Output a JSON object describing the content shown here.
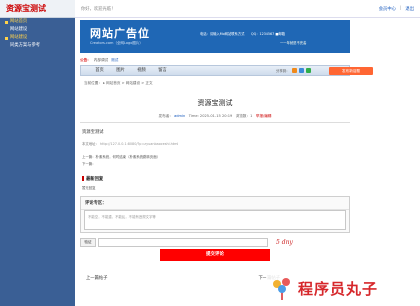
{
  "brand": {
    "title": "资源宝测试"
  },
  "sidebar": {
    "items": [
      {
        "label": "网站首页",
        "kind": "section"
      },
      {
        "label": "网站建设",
        "kind": "sub"
      },
      {
        "label": "网站建设",
        "kind": "section"
      },
      {
        "label": "同类方案与参考",
        "kind": "sub"
      }
    ]
  },
  "topbar": {
    "welcome": "你好，欢迎光临！",
    "member_center": "会员中心",
    "separator": "|",
    "logout": "退出"
  },
  "banner": {
    "logo_main": "网站广告位",
    "logo_sub": "Creators.com（全网Logo图片）",
    "contact": "电话：请输入Mo网站联系方式　　QQ：1234567    ■邮箱",
    "tagline": "一一年就是不完善"
  },
  "notice": {
    "label": "公告：",
    "text": "内部调试",
    "link": "测试"
  },
  "nav": {
    "tabs": [
      "首页",
      "图片",
      "视频",
      "留言"
    ],
    "share_label": "分享到：",
    "publish_button": "发布新话题"
  },
  "breadcrumb": "当前位置： ▸ 网站首页 > 网站建设 > 正文",
  "article": {
    "title": "资源宝测试",
    "meta_author_label": "发布者：",
    "meta_author": "admin",
    "meta_time": "Time: 2025-01-15 20:19",
    "meta_views": "浏览数：1",
    "meta_report": "举报/编辑",
    "body_title": "资源宝测试",
    "url_label": "本文地址：",
    "url": "http://127.0.0.1:8080/?p=zyuanbaoceshi.html",
    "prev": "上一篇：朴素系统，何时结束（朴素系统跳转页面）",
    "next": "下一篇：",
    "latest_heading": "最新回复",
    "latest_link": "暂无回复"
  },
  "comment": {
    "heading": "评论专区：",
    "placeholder": "不能空，不能重，不能乱，不能有违规文字等",
    "captcha_label": "验证",
    "captcha_image_text": "5 dny",
    "submit_label": "提交评论"
  },
  "footer_links": {
    "prev_post": "上一篇帖子",
    "next_post": "下一篇帖子"
  },
  "watermark": {
    "text": "程序员丸子"
  },
  "colors": {
    "sidebar": "#3a5f95",
    "banner": "#1f67b5",
    "accent_red": "#ff0000",
    "publish_orange": "#ff6633"
  }
}
